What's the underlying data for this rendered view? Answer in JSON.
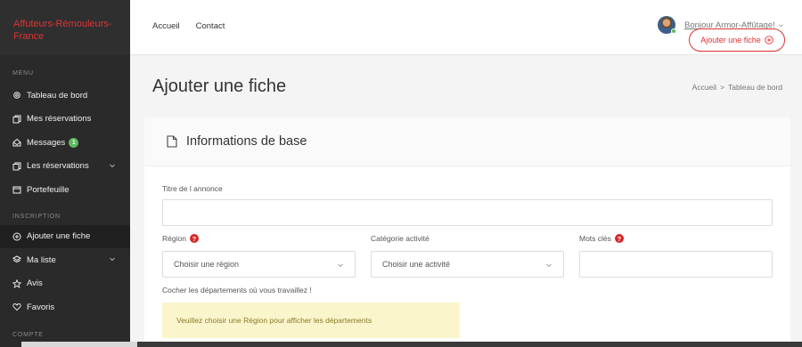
{
  "brand": {
    "name": "Affuteurs-Rémouleurs-France"
  },
  "sidebar": {
    "sections": {
      "menu": "MENU",
      "inscription": "INSCRIPTION",
      "compte": "COMPTE"
    },
    "items": [
      {
        "label": "Tableau de bord",
        "icon": "gear-icon"
      },
      {
        "label": "Mes réservations",
        "icon": "copy-icon"
      },
      {
        "label": "Messages",
        "icon": "inbox-icon",
        "badge": "1"
      },
      {
        "label": "Les réservations",
        "icon": "copy-icon",
        "has_submenu": true
      },
      {
        "label": "Portefeuille",
        "icon": "wallet-icon"
      },
      {
        "label": "Ajouter une fiche",
        "icon": "plus-circle-icon",
        "active": true
      },
      {
        "label": "Ma liste",
        "icon": "layers-icon",
        "has_submenu": true
      },
      {
        "label": "Avis",
        "icon": "star-icon"
      },
      {
        "label": "Favoris",
        "icon": "heart-icon"
      }
    ]
  },
  "topbar": {
    "nav": [
      "Accueil",
      "Contact"
    ],
    "greeting": "Bonjour Armor-Affûtage!",
    "add_button": "Ajouter une fiche"
  },
  "main": {
    "title": "Ajouter une fiche",
    "breadcrumb": [
      "Accueil",
      ">",
      "Tableau de bord"
    ]
  },
  "form": {
    "section_title": "Informations de base",
    "title_label": "Titre de l annonce",
    "title_value": "",
    "region_label": "Région",
    "region_placeholder": "Choisir une région",
    "category_label": "Catégorie activité",
    "category_placeholder": "Choisir une activité",
    "keywords_label": "Mots clés",
    "keywords_value": "",
    "help_mark": "?",
    "departments_label": "Cocher les départements où vous travaillez !",
    "departments_notice": "Veuillez choisir une Région pour afficher les départements"
  },
  "colors": {
    "accent": "#e03131",
    "sidebar_bg": "#2a2a2a",
    "badge_green": "#5cb85c",
    "notice_bg": "#fbf5cc"
  }
}
